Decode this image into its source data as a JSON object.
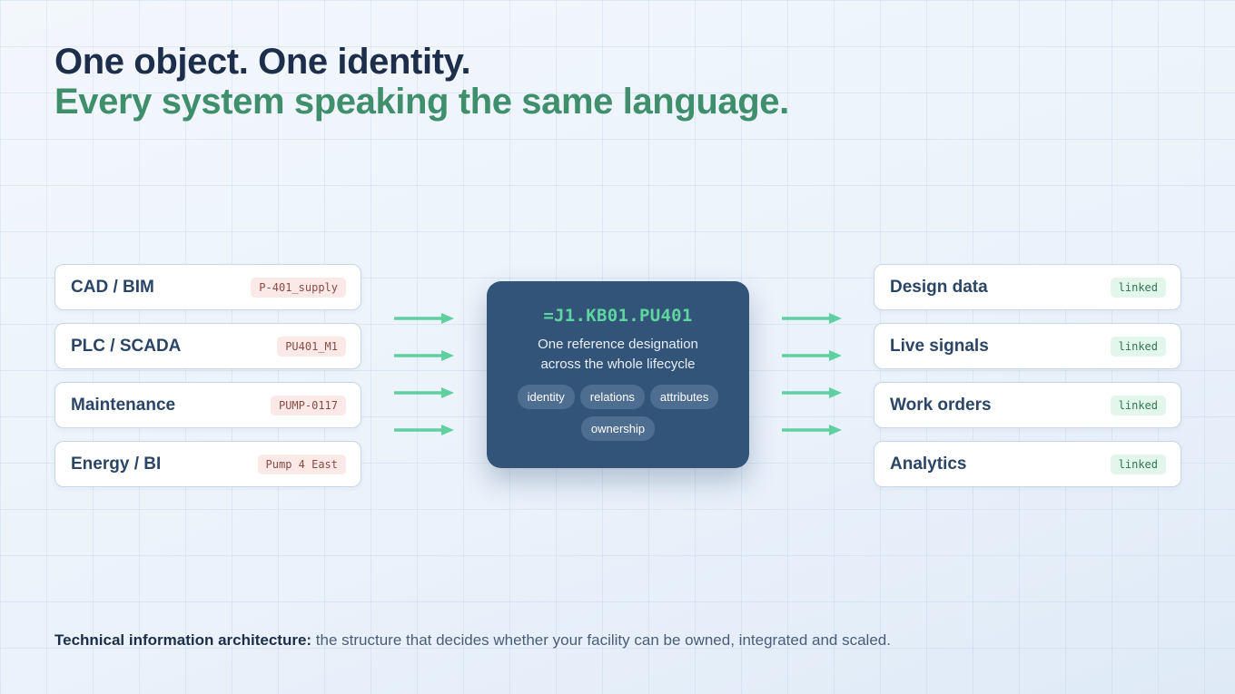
{
  "headline": {
    "line1": "One object. One identity.",
    "line2": "Every system speaking the same language."
  },
  "sources": [
    {
      "label": "CAD / BIM",
      "tag": "P-401_supply"
    },
    {
      "label": "PLC / SCADA",
      "tag": "PU401_M1"
    },
    {
      "label": "Maintenance",
      "tag": "PUMP-0117"
    },
    {
      "label": "Energy / BI",
      "tag": "Pump 4 East"
    }
  ],
  "hub": {
    "code": "=J1.KB01.PU401",
    "description": "One reference designation across the whole lifecycle",
    "pills": [
      "identity",
      "relations",
      "attributes",
      "ownership"
    ]
  },
  "targets": [
    {
      "label": "Design data",
      "tag": "linked"
    },
    {
      "label": "Live signals",
      "tag": "linked"
    },
    {
      "label": "Work orders",
      "tag": "linked"
    },
    {
      "label": "Analytics",
      "tag": "linked"
    }
  ],
  "footer": {
    "bold": "Technical information architecture:",
    "text": " the structure that decides whether your facility can be owned, integrated and scaled."
  },
  "colors": {
    "heading": "#1c2e4a",
    "accent_green": "#3f8f6c",
    "arrow": "#5fd09f",
    "hub_bg": "#325478",
    "hub_code": "#5fd6a0",
    "source_tag_bg": "#fbe9e7",
    "linked_tag_bg": "#e3f6ec"
  },
  "icons": {
    "connector": "right-arrow-icon"
  }
}
